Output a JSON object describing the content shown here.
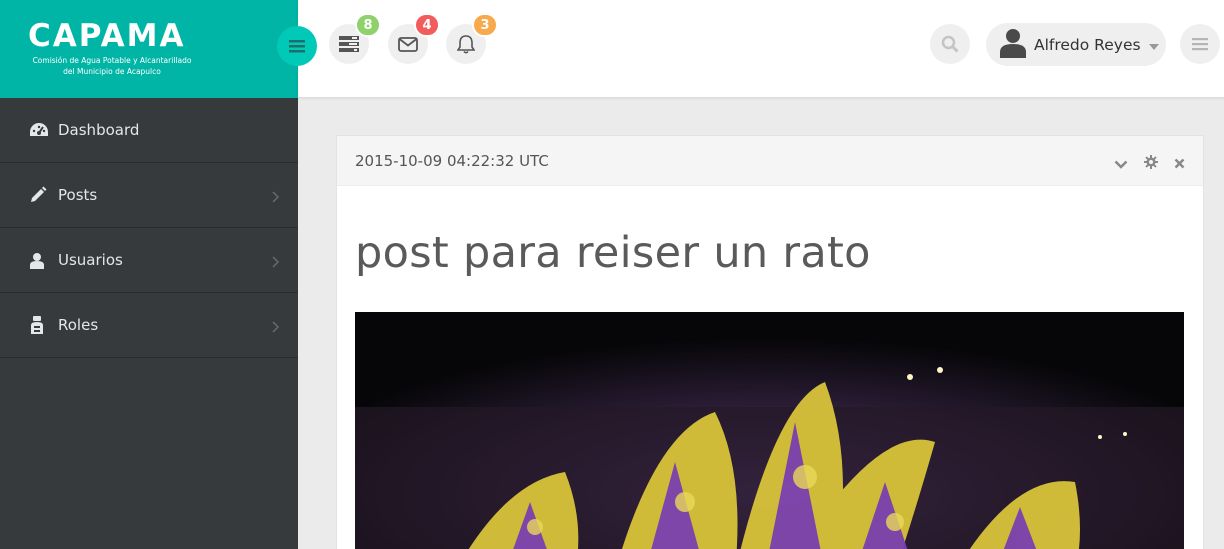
{
  "brand": {
    "title": "CAPAMA",
    "subtitle": "Comisión de Agua Potable y Alcantarillado del Municipio de Acapulco"
  },
  "sidebar": {
    "items": [
      {
        "label": "Dashboard",
        "icon": "dashboard-icon"
      },
      {
        "label": "Posts",
        "icon": "pencil-icon"
      },
      {
        "label": "Usuarios",
        "icon": "user-icon"
      },
      {
        "label": "Roles",
        "icon": "roles-icon"
      }
    ]
  },
  "header": {
    "tasks_count": "8",
    "messages_count": "4",
    "notifications_count": "3",
    "user_name": "Alfredo Reyes"
  },
  "colors": {
    "brand": "#00b5a5",
    "sidebar": "#363a3d",
    "badge_green": "#8fd26b",
    "badge_red": "#f25c5c",
    "badge_orange": "#f8a94b"
  },
  "post": {
    "timestamp": "2015-10-09 04:22:32 UTC",
    "title": "post para reiser un rato"
  }
}
